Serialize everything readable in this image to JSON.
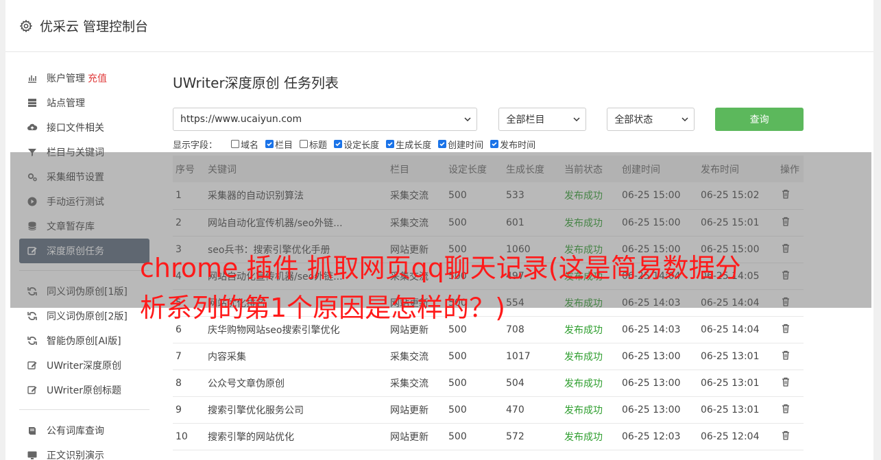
{
  "header": {
    "title": "优采云 管理控制台",
    "icon": "gear-icon"
  },
  "sidebar": {
    "items": [
      {
        "label": "账户管理",
        "extra": "充值",
        "icon": "bar-chart-icon"
      },
      {
        "label": "站点管理",
        "icon": "server-icon"
      },
      {
        "label": "接口文件相关",
        "icon": "cloud-upload-icon"
      },
      {
        "label": "栏目与关键词",
        "icon": "filter-icon"
      },
      {
        "label": "采集细节设置",
        "icon": "gears-icon"
      },
      {
        "label": "手动运行测试",
        "icon": "play-circle-icon"
      },
      {
        "label": "文章暂存库",
        "icon": "database-icon"
      },
      {
        "label": "深度原创任务",
        "icon": "edit-icon",
        "active": true
      },
      {
        "label": "同义词伪原创[1版]",
        "icon": "refresh-icon"
      },
      {
        "label": "同义词伪原创[2版]",
        "icon": "refresh-icon"
      },
      {
        "label": "智能伪原创[AI版]",
        "icon": "refresh-icon"
      },
      {
        "label": "UWriter深度原创",
        "icon": "edit-icon"
      },
      {
        "label": "UWriter原创标题",
        "icon": "edit-icon"
      },
      {
        "label": "公有词库查询",
        "icon": "book-icon"
      },
      {
        "label": "正文识别演示",
        "icon": "monitor-icon"
      }
    ]
  },
  "main": {
    "title": "UWriter深度原创 任务列表",
    "filters": {
      "site": "https://www.ucaiyun.com",
      "category": "全部栏目",
      "status": "全部状态",
      "query_label": "查询"
    },
    "fields": {
      "label": "显示字段：",
      "options": [
        {
          "label": "域名",
          "checked": false
        },
        {
          "label": "栏目",
          "checked": true
        },
        {
          "label": "标题",
          "checked": false
        },
        {
          "label": "设定长度",
          "checked": true
        },
        {
          "label": "生成长度",
          "checked": true
        },
        {
          "label": "创建时间",
          "checked": true
        },
        {
          "label": "发布时间",
          "checked": true
        }
      ]
    },
    "table": {
      "headers": [
        "序号",
        "关键词",
        "栏目",
        "设定长度",
        "生成长度",
        "当前状态",
        "创建时间",
        "发布时间",
        "操作"
      ],
      "rows": [
        [
          "1",
          "采集器的自动识别算法",
          "采集交流",
          "500",
          "533",
          "发布成功",
          "06-25 15:00",
          "06-25 15:02"
        ],
        [
          "2",
          "网站自动化宣传机器/seo外链...",
          "采集交流",
          "500",
          "601",
          "发布成功",
          "06-25 15:00",
          "06-25 15:01"
        ],
        [
          "3",
          "seo兵书：搜索引擎优化手册",
          "网站更新",
          "500",
          "1060",
          "发布成功",
          "06-25 15:00",
          "06-25 15:00"
        ],
        [
          "4",
          "网站自动化宣传机器/seo外链...",
          "采集交流",
          "500",
          "497",
          "发布成功",
          "06-25 14:04",
          "06-25 14:05"
        ],
        [
          "5",
          "网站优化排名",
          "网站更新",
          "500",
          "554",
          "发布成功",
          "06-25 14:03",
          "06-25 14:04"
        ],
        [
          "6",
          "庆华购物网站seo搜索引擎优化",
          "网站更新",
          "500",
          "708",
          "发布成功",
          "06-25 14:03",
          "06-25 14:04"
        ],
        [
          "7",
          "内容采集",
          "采集交流",
          "500",
          "1017",
          "发布成功",
          "06-25 13:00",
          "06-25 13:01"
        ],
        [
          "8",
          "公众号文章伪原创",
          "采集交流",
          "500",
          "504",
          "发布成功",
          "06-25 13:00",
          "06-25 13:01"
        ],
        [
          "9",
          "搜索引擎优化服务公司",
          "网站更新",
          "500",
          "470",
          "发布成功",
          "06-25 13:00",
          "06-25 13:01"
        ],
        [
          "10",
          "搜索引擎的网站优化",
          "网站更新",
          "500",
          "572",
          "发布成功",
          "06-25 12:03",
          "06-25 12:04"
        ]
      ]
    }
  },
  "watermark": "chrome 插件 抓取网页qq聊天记录(这是简易数据分析系列的第1个原因是怎样的？)",
  "colors": {
    "active_bg": "#5b6a7d",
    "query_btn": "#5cb85c",
    "success": "#2e9e2e",
    "accent_red": "#e03c3c"
  }
}
